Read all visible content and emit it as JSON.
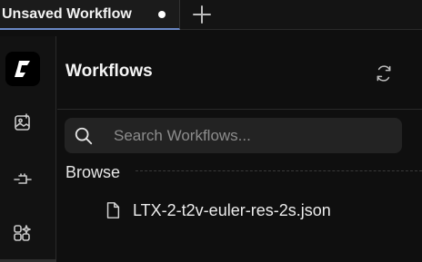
{
  "tabs": [
    {
      "title": "Unsaved Workflow",
      "unsaved": true
    }
  ],
  "icons": {
    "new_tab": "plus-icon",
    "logo": "comfy-logo-icon",
    "rail": [
      "image-gallery-icon",
      "node-library-icon",
      "templates-icon"
    ],
    "refresh": "refresh-icon",
    "search": "search-icon",
    "file": "file-icon"
  },
  "panel": {
    "title": "Workflows",
    "search": {
      "placeholder": "Search Workflows...",
      "value": ""
    },
    "sections": [
      {
        "label": "Browse",
        "files": [
          "LTX-2-t2v-euler-res-2s.json"
        ]
      }
    ]
  },
  "colors": {
    "accent_underline": "#6b89c6",
    "background": "#0f0f0f",
    "search_bg": "#232323"
  }
}
